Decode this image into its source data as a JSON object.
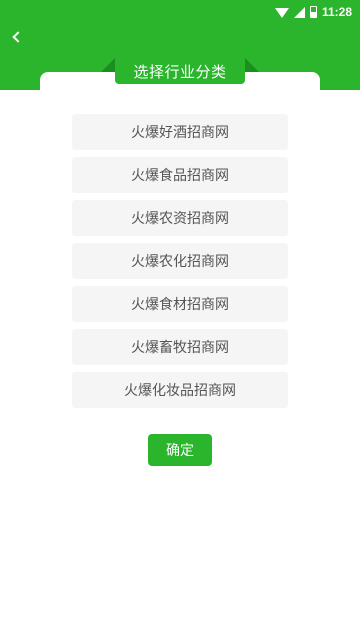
{
  "status_bar": {
    "time": "11:28",
    "icons": [
      "wifi-icon",
      "signal-icon",
      "battery-icon"
    ]
  },
  "header": {
    "back_icon": "chevron-left-icon",
    "title": "选择行业分类"
  },
  "options": [
    {
      "label": "火爆好酒招商网"
    },
    {
      "label": "火爆食品招商网"
    },
    {
      "label": "火爆农资招商网"
    },
    {
      "label": "火爆农化招商网"
    },
    {
      "label": "火爆食材招商网"
    },
    {
      "label": "火爆畜牧招商网"
    },
    {
      "label": "火爆化妆品招商网"
    }
  ],
  "confirm": {
    "label": "确定"
  },
  "colors": {
    "accent": "#2ab52d",
    "accent_dark": "#1c8e1f",
    "option_bg": "#f5f5f5",
    "option_text": "#555555"
  }
}
